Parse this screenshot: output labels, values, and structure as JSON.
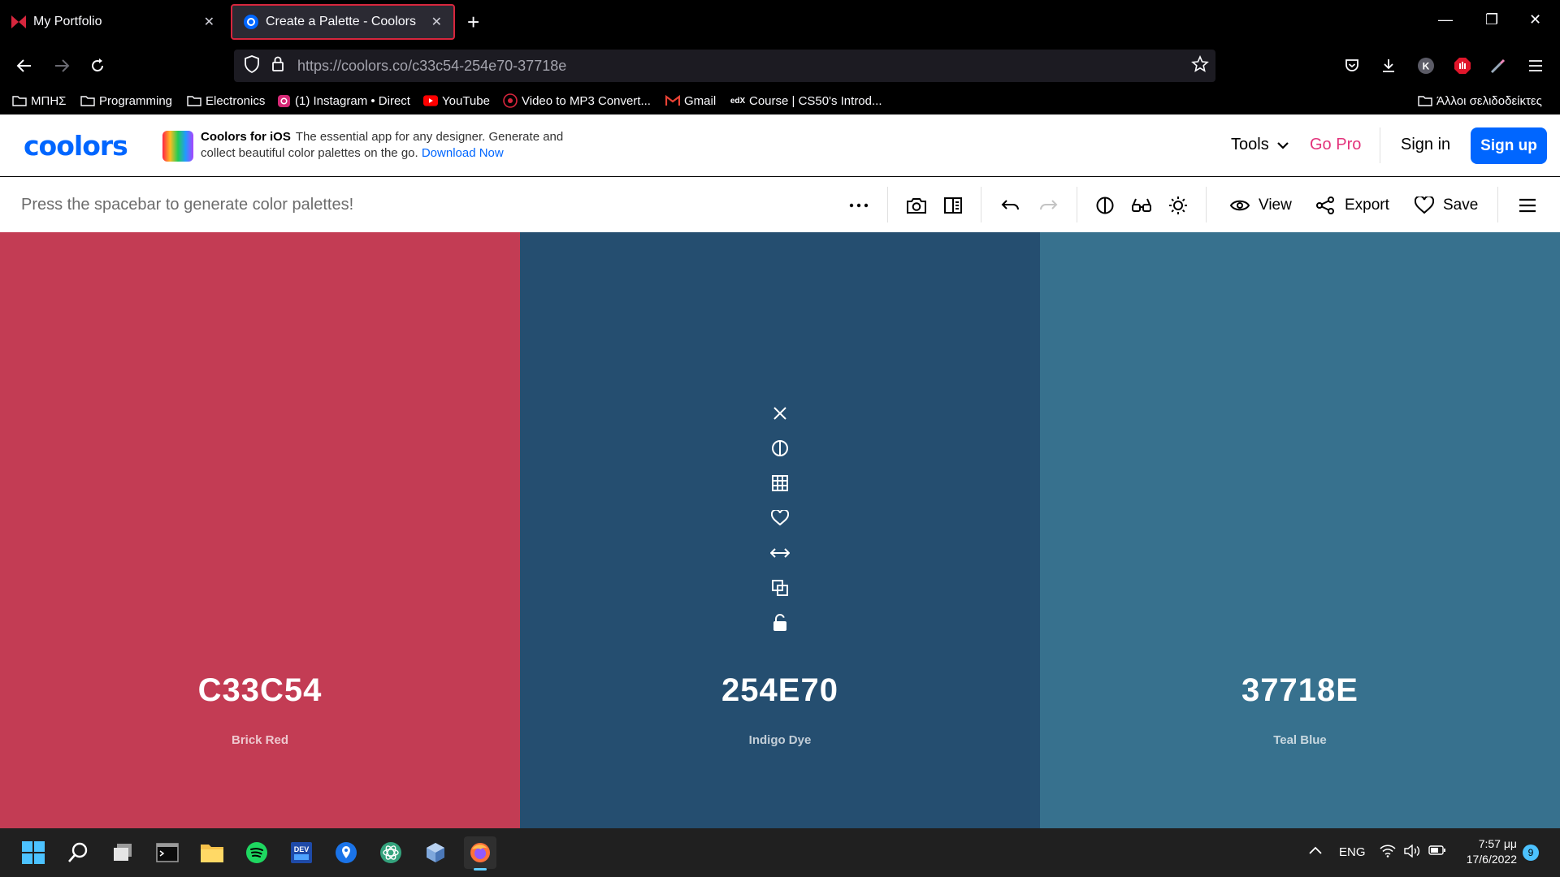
{
  "browser": {
    "tabs": [
      {
        "title": "My Portfolio",
        "active": false
      },
      {
        "title": "Create a Palette - Coolors",
        "active": true
      }
    ],
    "url_host": "https://coolors.co/",
    "url_path": "c33c54-254e70-37718e",
    "bookmarks": [
      {
        "label": "ΜΠΗΣ",
        "icon": "folder-icon"
      },
      {
        "label": "Programming",
        "icon": "folder-icon"
      },
      {
        "label": "Electronics",
        "icon": "folder-icon"
      },
      {
        "label": "(1) Instagram • Direct",
        "icon": "instagram-icon"
      },
      {
        "label": "YouTube",
        "icon": "youtube-icon"
      },
      {
        "label": "Video to MP3 Convert...",
        "icon": "converter-icon"
      },
      {
        "label": "Gmail",
        "icon": "gmail-icon"
      },
      {
        "label": "Course | CS50's Introd...",
        "icon": "edx-icon"
      }
    ],
    "other_bookmarks": "Άλλοι σελιδοδείκτες"
  },
  "header": {
    "logo": "coolors",
    "promo_title": "Coolors for iOS",
    "promo_text": "The essential app for any designer. Generate and collect beautiful color palettes on the go.",
    "promo_link": "Download Now",
    "tools": "Tools",
    "go_pro": "Go Pro",
    "sign_in": "Sign in",
    "sign_up": "Sign up"
  },
  "toolbar": {
    "hint": "Press the spacebar to generate color palettes!",
    "view": "View",
    "export": "Export",
    "save": "Save"
  },
  "palette": [
    {
      "hex": "C33C54",
      "name": "Brick Red",
      "color": "#c33c54"
    },
    {
      "hex": "254E70",
      "name": "Indigo Dye",
      "color": "#254e70"
    },
    {
      "hex": "37718E",
      "name": "Teal Blue",
      "color": "#37718e"
    }
  ],
  "taskbar": {
    "lang": "ENG",
    "time": "7:57 μμ",
    "date": "17/6/2022",
    "notifications": "9"
  },
  "colors": {
    "accent": "#0066ff",
    "go_pro": "#e3327b"
  }
}
